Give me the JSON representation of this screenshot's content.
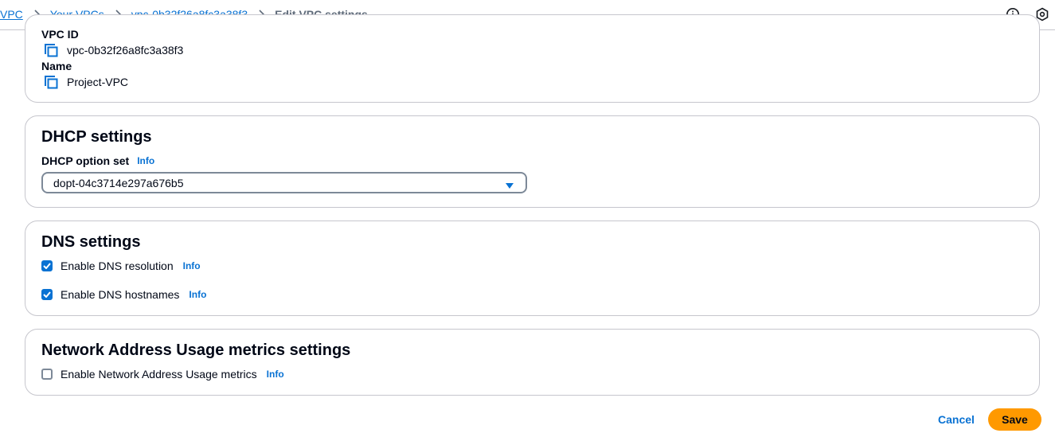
{
  "breadcrumb": {
    "items": [
      {
        "label": "VPC"
      },
      {
        "label": "Your VPCs"
      },
      {
        "label": "vpc-0b32f26a8fc3a38f3"
      }
    ],
    "current": "Edit VPC settings"
  },
  "details": {
    "vpc_id_label": "VPC ID",
    "vpc_id_value": "vpc-0b32f26a8fc3a38f3",
    "name_label": "Name",
    "name_value": "Project-VPC"
  },
  "dhcp": {
    "title": "DHCP settings",
    "option_set_label": "DHCP option set",
    "info": "Info",
    "selected_value": "dopt-04c3714e297a676b5"
  },
  "dns": {
    "title": "DNS settings",
    "resolution_label": "Enable DNS resolution",
    "resolution_checked": true,
    "hostnames_label": "Enable DNS hostnames",
    "hostnames_checked": true,
    "info": "Info"
  },
  "nau": {
    "title": "Network Address Usage metrics settings",
    "metrics_label": "Enable Network Address Usage metrics",
    "metrics_checked": false,
    "info": "Info"
  },
  "actions": {
    "cancel_label": "Cancel",
    "save_label": "Save"
  },
  "colors": {
    "link": "#0972d3",
    "primary_button": "#ff9900",
    "border": "#c6c6cd"
  }
}
